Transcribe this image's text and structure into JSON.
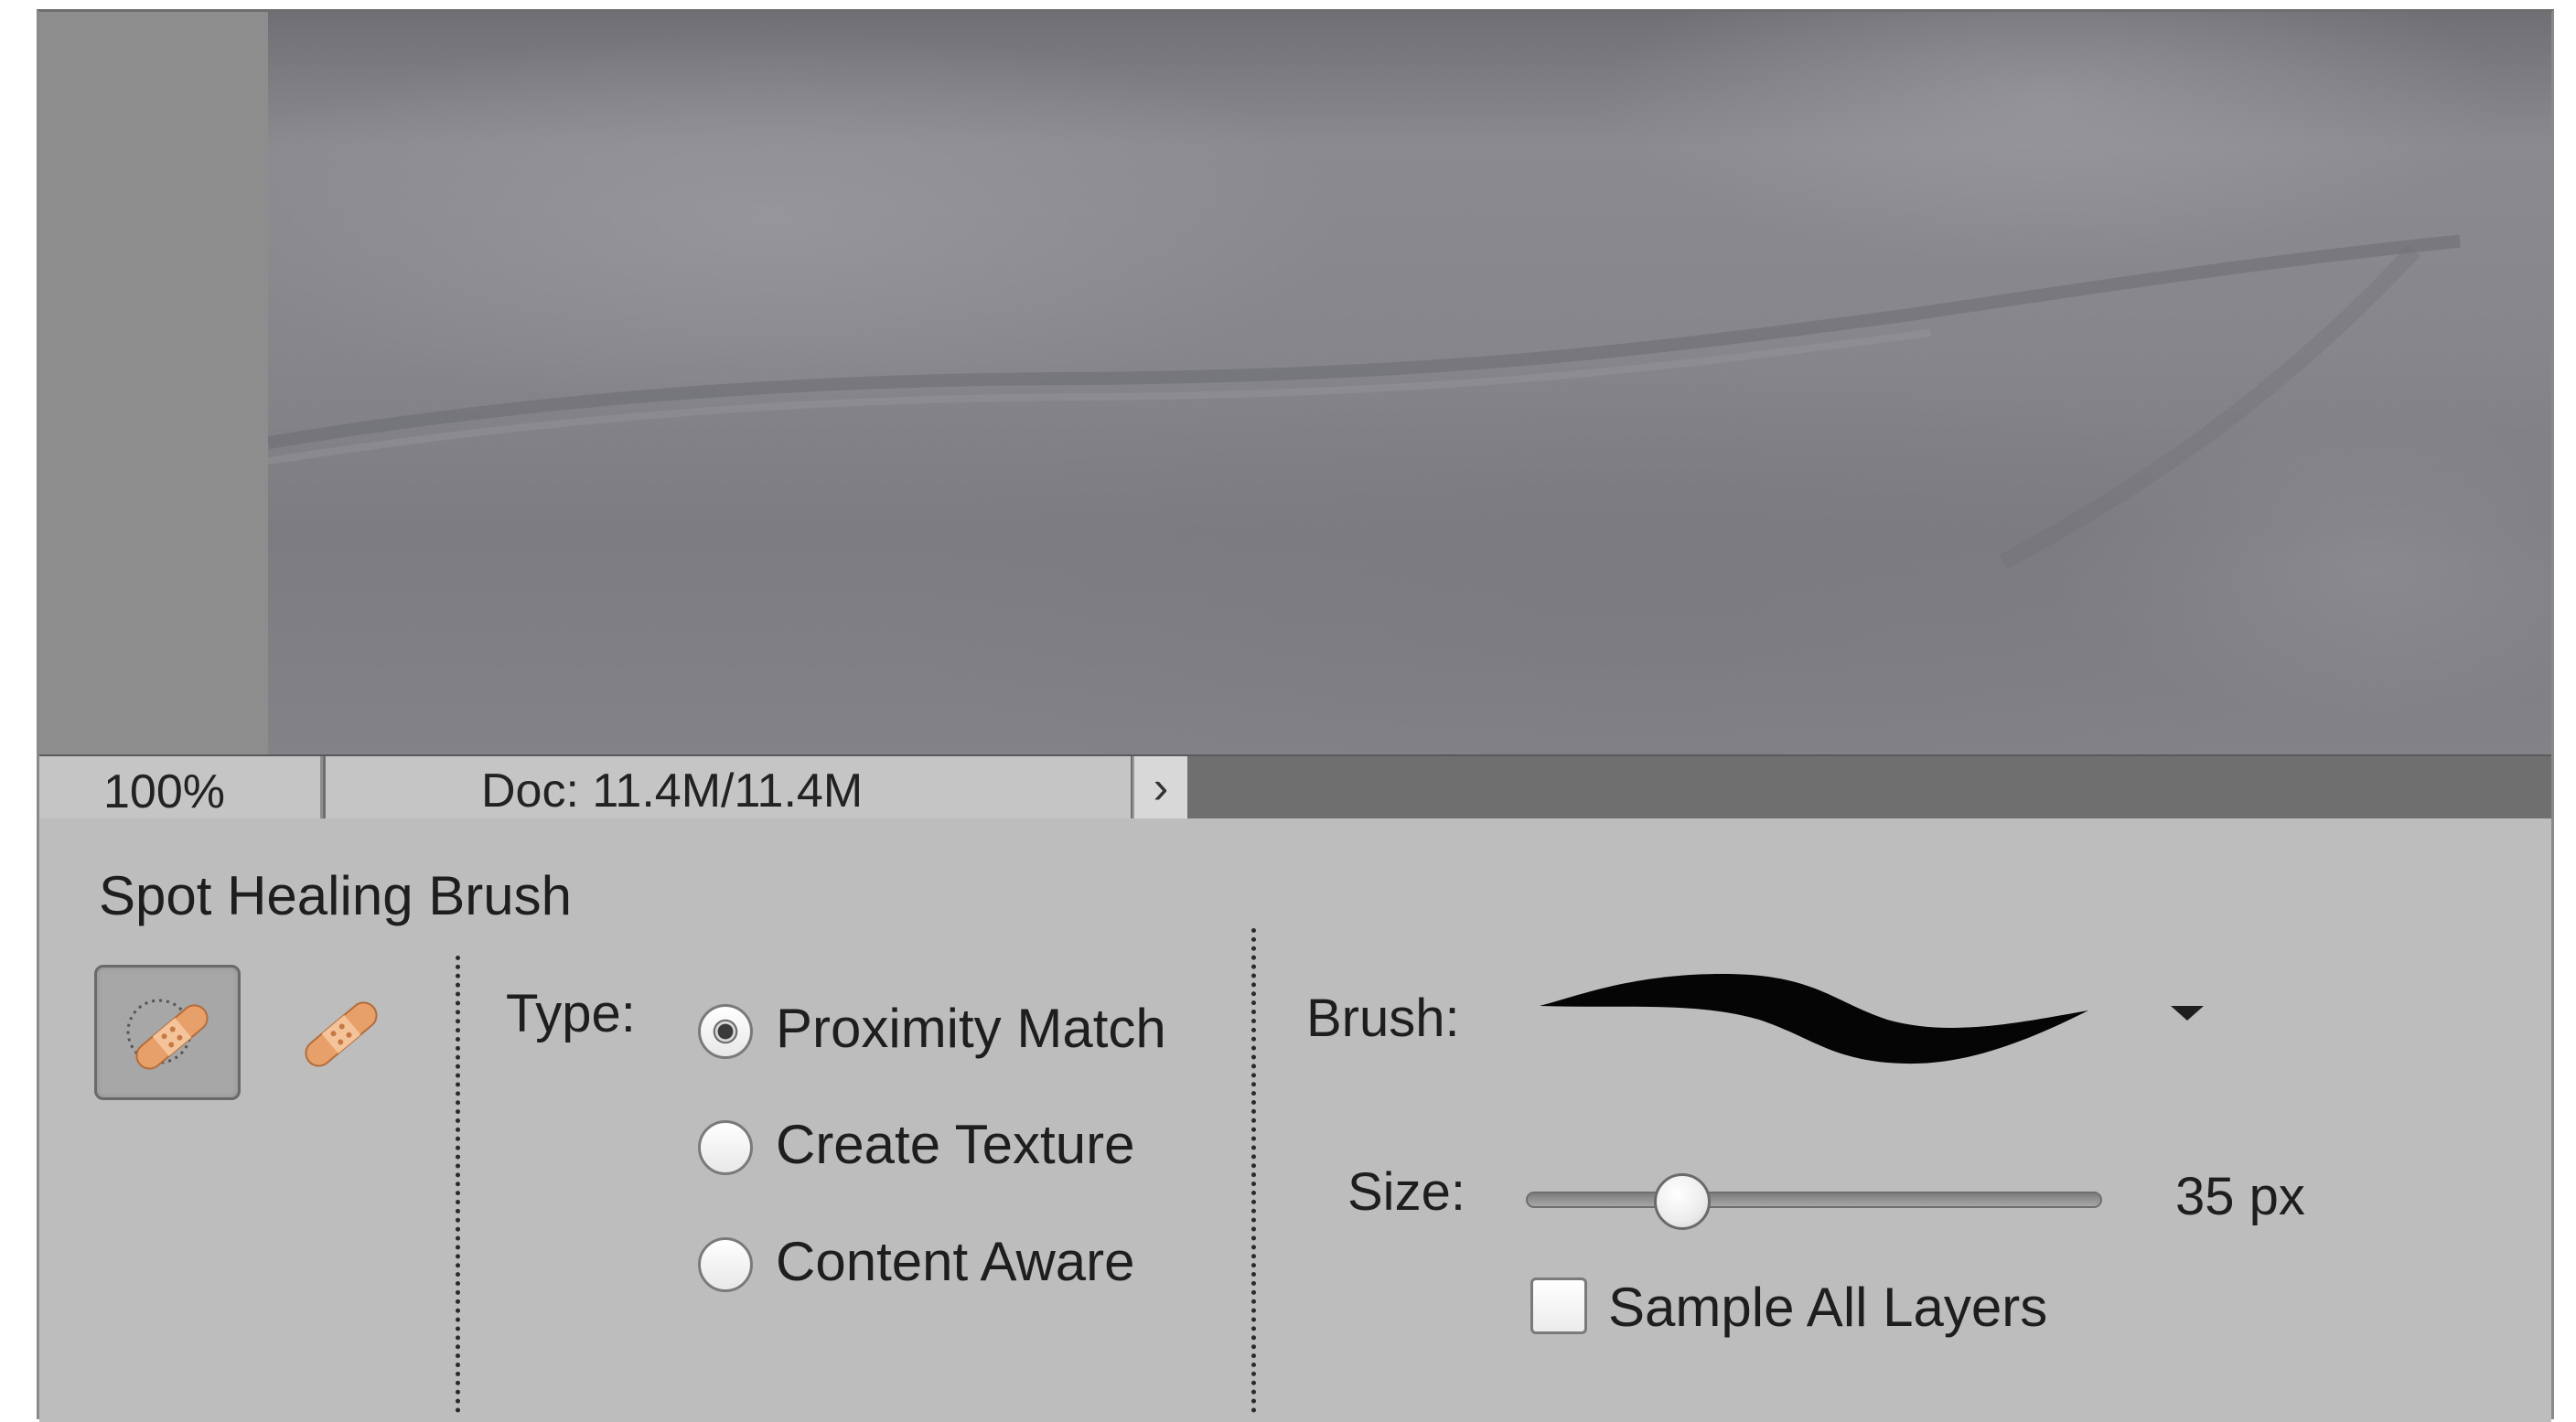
{
  "status": {
    "zoom": "100%",
    "doc_info": "Doc: 11.4M/11.4M",
    "arrow_glyph": "›"
  },
  "options": {
    "tool_name": "Spot Healing Brush",
    "tools": [
      {
        "icon": "spot-healing-brush-icon",
        "active": true
      },
      {
        "icon": "healing-brush-icon",
        "active": false
      }
    ],
    "type_label": "Type:",
    "types": [
      {
        "label": "Proximity Match",
        "selected": true
      },
      {
        "label": "Create Texture",
        "selected": false
      },
      {
        "label": "Content Aware",
        "selected": false
      }
    ],
    "brush_label": "Brush:",
    "size_label": "Size:",
    "size_value": "35 px",
    "size_fraction": 0.27,
    "sample_all_layers_label": "Sample All Layers",
    "sample_all_layers_checked": false
  },
  "colors": {
    "panel_bg": "#bdbdbd",
    "bandage": "#e8a06a"
  }
}
